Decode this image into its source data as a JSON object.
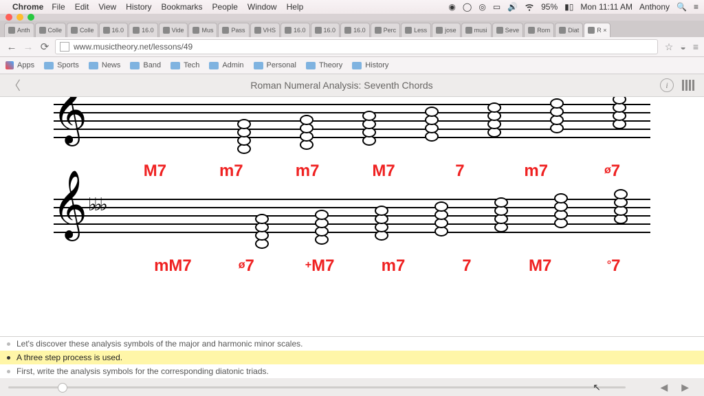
{
  "menubar": {
    "app": "Chrome",
    "items": [
      "File",
      "Edit",
      "View",
      "History",
      "Bookmarks",
      "People",
      "Window",
      "Help"
    ],
    "battery": "95%",
    "clock": "Mon 11:11 AM",
    "user": "Anthony"
  },
  "browser": {
    "tabs": [
      "Anth",
      "Colle",
      "Colle",
      "16.0",
      "16.0",
      "Vide",
      "Mus",
      "Pass",
      "VHS",
      "16.0",
      "16.0",
      "16.0",
      "Perc",
      "Less",
      "jose",
      "musi",
      "Seve",
      "Rom",
      "Diat",
      "R ×"
    ],
    "active_tab_index": 19,
    "url": "www.musictheory.net/lessons/49",
    "bookmarks": [
      "Apps",
      "Sports",
      "News",
      "Band",
      "Tech",
      "Admin",
      "Personal",
      "Theory",
      "History"
    ]
  },
  "lesson": {
    "title": "Roman Numeral Analysis: Seventh Chords",
    "row1_labels": [
      "M7",
      "m7",
      "m7",
      "M7",
      "7",
      "m7",
      "ø7"
    ],
    "row2_labels": [
      "mM7",
      "ø7",
      "+M7",
      "m7",
      "7",
      "M7",
      "°7"
    ],
    "script": [
      "Let's discover these analysis symbols of the major and harmonic minor scales.",
      "A three step process is used.",
      "First, write the analysis symbols for the corresponding diatonic triads."
    ],
    "script_active": 1,
    "progress_pct": 8
  }
}
